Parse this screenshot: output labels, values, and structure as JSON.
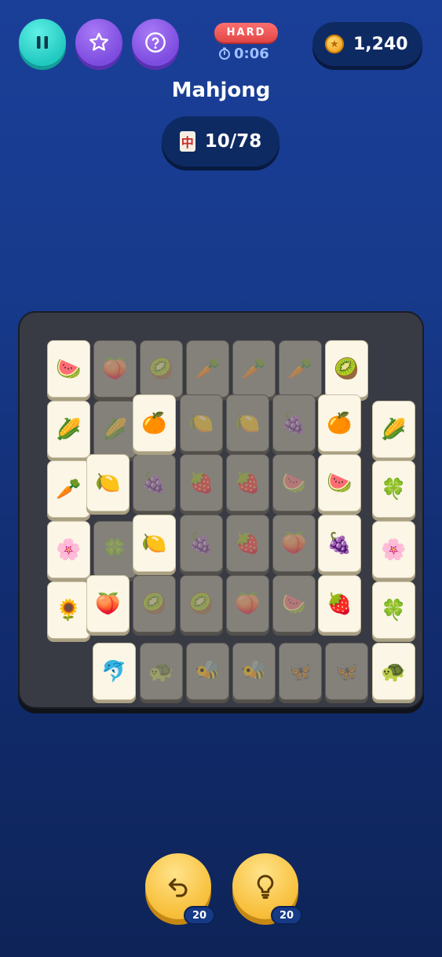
{
  "header": {
    "difficulty": "HARD",
    "timer": "0:06",
    "coins": "1,240",
    "title": "Mahjong",
    "progress": "10/78",
    "progress_icon": "🀄"
  },
  "controls": {
    "pause": "pause-icon",
    "favorite": "star-icon",
    "help": "question-icon"
  },
  "tiles": [
    {
      "glyph": "🍉",
      "state": "free",
      "pos": "r0c0"
    },
    {
      "glyph": "🍑",
      "state": "blocked",
      "pos": "r0c1"
    },
    {
      "glyph": "🥝",
      "state": "blocked",
      "pos": "r0c2"
    },
    {
      "glyph": "🥕",
      "state": "blocked",
      "pos": "r0c3"
    },
    {
      "glyph": "🥕",
      "state": "blocked",
      "pos": "r0c4"
    },
    {
      "glyph": "🥕",
      "state": "blocked",
      "pos": "r0c5"
    },
    {
      "glyph": "🥝",
      "state": "free",
      "pos": "r0c6"
    },
    {
      "glyph": "🌽",
      "state": "free",
      "pos": "r1c0"
    },
    {
      "glyph": "🌽",
      "state": "blocked",
      "pos": "r1c1"
    },
    {
      "glyph": "🍊",
      "state": "free",
      "pos": "r1c2"
    },
    {
      "glyph": "🍋",
      "state": "blocked",
      "pos": "r1c3"
    },
    {
      "glyph": "🍋",
      "state": "blocked",
      "pos": "r1c4"
    },
    {
      "glyph": "🍇",
      "state": "blocked",
      "pos": "r1c5"
    },
    {
      "glyph": "🍊",
      "state": "free",
      "pos": "r1c6"
    },
    {
      "glyph": "🌽",
      "state": "free",
      "pos": "r1c7"
    },
    {
      "glyph": "🥕",
      "state": "free",
      "pos": "r2c0"
    },
    {
      "glyph": "🍋",
      "state": "free",
      "pos": "r2c1"
    },
    {
      "glyph": "🍇",
      "state": "blocked",
      "pos": "r2c2"
    },
    {
      "glyph": "🍓",
      "state": "blocked",
      "pos": "r2c3"
    },
    {
      "glyph": "🍓",
      "state": "blocked",
      "pos": "r2c4"
    },
    {
      "glyph": "🍉",
      "state": "blocked",
      "pos": "r2c5"
    },
    {
      "glyph": "🍉",
      "state": "free",
      "pos": "r2c6"
    },
    {
      "glyph": "🍀",
      "state": "free",
      "pos": "r2c7"
    },
    {
      "glyph": "🌸",
      "state": "free",
      "pos": "r3c0"
    },
    {
      "glyph": "🍀",
      "state": "blocked",
      "pos": "r3c1"
    },
    {
      "glyph": "🍋",
      "state": "free",
      "pos": "r3c2"
    },
    {
      "glyph": "🍇",
      "state": "blocked",
      "pos": "r3c3"
    },
    {
      "glyph": "🍓",
      "state": "blocked",
      "pos": "r3c4"
    },
    {
      "glyph": "🍑",
      "state": "blocked",
      "pos": "r3c5"
    },
    {
      "glyph": "🍇",
      "state": "free",
      "pos": "r3c6"
    },
    {
      "glyph": "🌸",
      "state": "free",
      "pos": "r3c7"
    },
    {
      "glyph": "🌻",
      "state": "free",
      "pos": "r4c0"
    },
    {
      "glyph": "🍑",
      "state": "free",
      "pos": "r4c1"
    },
    {
      "glyph": "🥝",
      "state": "blocked",
      "pos": "r4c2"
    },
    {
      "glyph": "🥝",
      "state": "blocked",
      "pos": "r4c3"
    },
    {
      "glyph": "🍑",
      "state": "blocked",
      "pos": "r4c4"
    },
    {
      "glyph": "🍉",
      "state": "blocked",
      "pos": "r4c5"
    },
    {
      "glyph": "🍓",
      "state": "free",
      "pos": "r4c6"
    },
    {
      "glyph": "🍀",
      "state": "free",
      "pos": "r4c7"
    },
    {
      "glyph": "🐬",
      "state": "free",
      "pos": "r5c1"
    },
    {
      "glyph": "🐢",
      "state": "blocked",
      "pos": "r5c2"
    },
    {
      "glyph": "🐝",
      "state": "blocked",
      "pos": "r5c3"
    },
    {
      "glyph": "🐝",
      "state": "blocked",
      "pos": "r5c4"
    },
    {
      "glyph": "🦋",
      "state": "blocked",
      "pos": "r5c5"
    },
    {
      "glyph": "🦋",
      "state": "blocked",
      "pos": "r5c6"
    },
    {
      "glyph": "🐢",
      "state": "free",
      "pos": "r5c7"
    }
  ],
  "actions": {
    "undo_icon": "undo-icon",
    "undo_count": "20",
    "hint_icon": "lightbulb-icon",
    "hint_count": "20"
  }
}
